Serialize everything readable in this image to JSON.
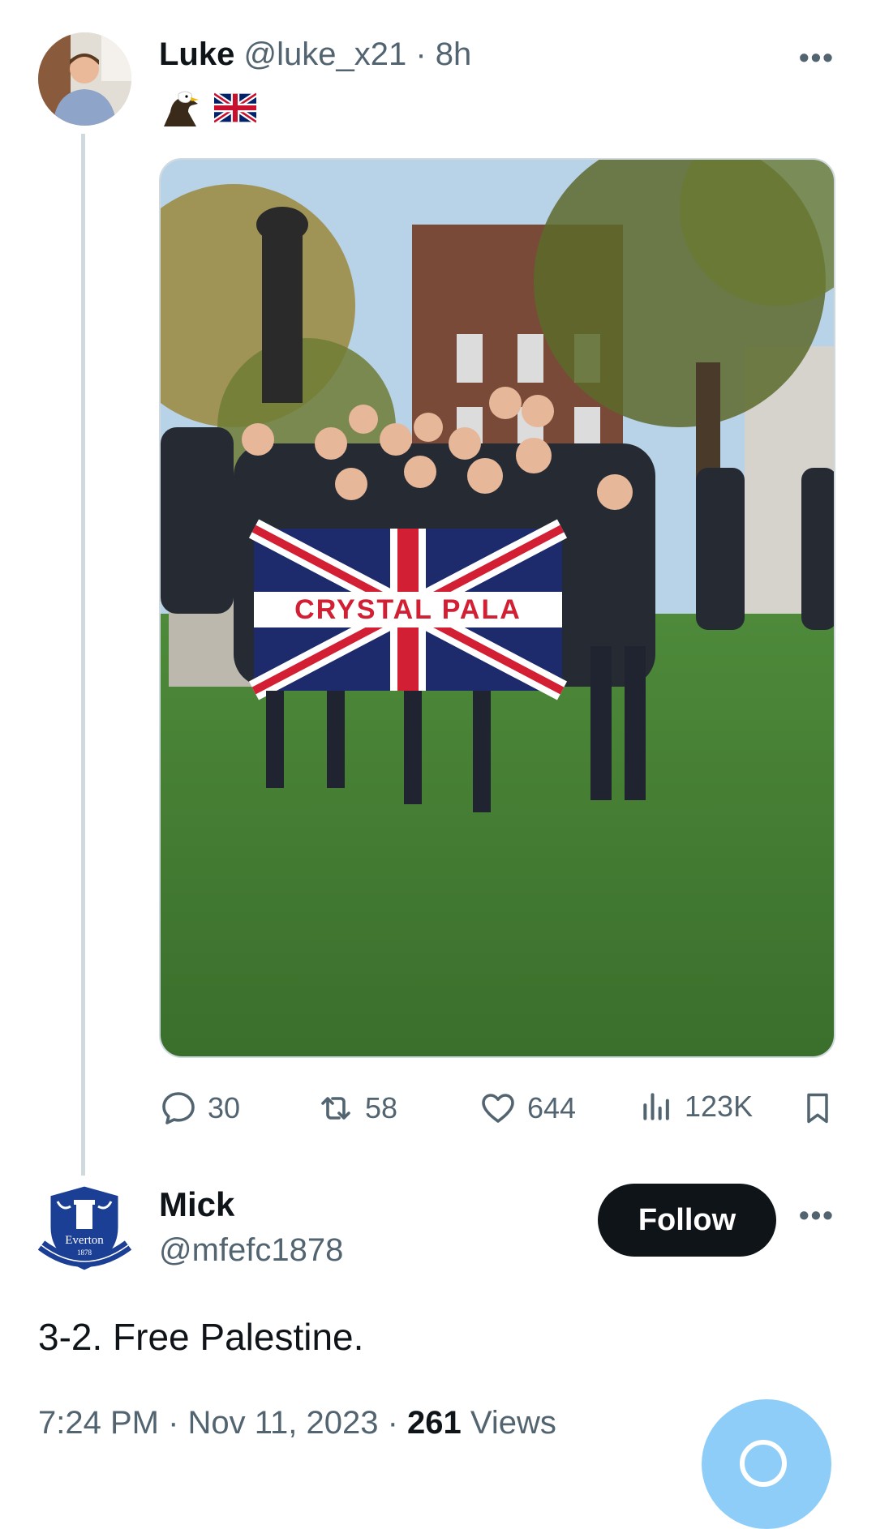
{
  "post": {
    "author_name": "Luke",
    "author_handle": "@luke_x21",
    "separator": " · ",
    "time_ago": "8h",
    "bio_emojis": [
      "eagle",
      "union-jack"
    ],
    "more_label": "•••",
    "media_flag_text": "CRYSTAL PALA",
    "actions": {
      "replies": "30",
      "reposts": "58",
      "likes": "644",
      "views": "123K"
    }
  },
  "reply": {
    "author_name": "Mick",
    "author_handle": "@mfefc1878",
    "avatar_badge_text": "Everton",
    "avatar_badge_year": "1878",
    "follow_label": "Follow",
    "more_label": "•••",
    "text": "3-2. Free Palestine.",
    "time": "7:24 PM",
    "date": "Nov 11, 2023",
    "views_count": "261",
    "views_label": "Views"
  },
  "colors": {
    "text_primary": "#0f1419",
    "text_secondary": "#536471",
    "thread_line": "#cfd9de",
    "fab": "#8ecdf8",
    "everton_blue": "#1b3f94"
  }
}
